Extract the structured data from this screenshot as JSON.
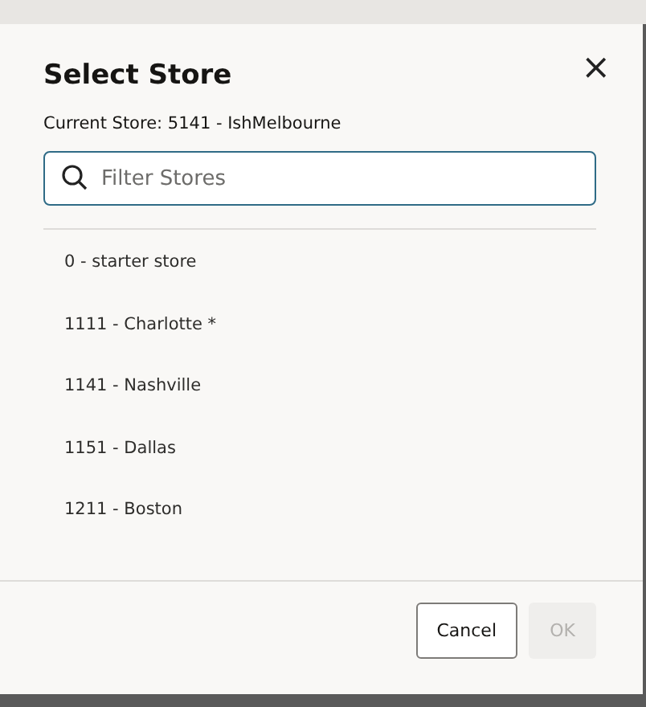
{
  "dialog": {
    "title": "Select Store",
    "close_icon": "×",
    "current_store": "Current Store: 5141 - IshMelbourne",
    "search": {
      "placeholder": "Filter Stores"
    },
    "stores": [
      {
        "label": "0 - starter store"
      },
      {
        "label": "1111 - Charlotte *"
      },
      {
        "label": "1141 - Nashville"
      },
      {
        "label": "1151 - Dallas"
      },
      {
        "label": "1211 - Boston"
      }
    ],
    "buttons": [
      {
        "label": "Cancel",
        "disabled": false
      },
      {
        "label": "OK",
        "disabled": true
      }
    ]
  }
}
